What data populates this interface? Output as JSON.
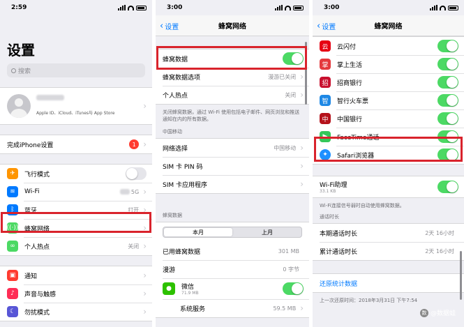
{
  "panel1": {
    "time": "2:59",
    "title": "设置",
    "search_placeholder": "搜索",
    "profile": {
      "subtitle": "Apple ID、iCloud、iTunes与 App Store"
    },
    "setup": {
      "label": "完成iPhone设置",
      "badge": "1"
    },
    "rows": [
      {
        "label": "飞行模式",
        "icon": "airplane-icon",
        "color": "#ff9500"
      },
      {
        "label": "Wi-Fi",
        "icon": "wifi-icon",
        "color": "#007aff",
        "value": "5G"
      },
      {
        "label": "蓝牙",
        "icon": "bluetooth-icon",
        "color": "#007aff",
        "value": "打开"
      },
      {
        "label": "蜂窝网络",
        "icon": "cellular-icon",
        "color": "#4cd964"
      },
      {
        "label": "个人热点",
        "icon": "hotspot-icon",
        "color": "#4cd964",
        "value": "关闭"
      }
    ],
    "rows2": [
      {
        "label": "通知",
        "icon": "notification-icon",
        "color": "#ff3b30"
      },
      {
        "label": "声音与触感",
        "icon": "sound-icon",
        "color": "#ff2d55"
      },
      {
        "label": "勿扰模式",
        "icon": "moon-icon",
        "color": "#5856d6"
      }
    ]
  },
  "panel2": {
    "time": "3:00",
    "back": "设置",
    "title": "蜂窝网络",
    "cellular_data": "蜂窝数据",
    "options": {
      "label": "蜂窝数据选项",
      "value": "漫游已关闭"
    },
    "hotspot": {
      "label": "个人热点",
      "value": "关闭"
    },
    "footnote": "关闭蜂窝数据，通过 Wi-Fi 使用包括电子邮件、网页浏览和推送通知在内的所有数据。",
    "carrier_header": "中国移动",
    "carrier_rows": [
      {
        "label": "网络选择",
        "value": "中国移动"
      },
      {
        "label": "SIM 卡 PIN 码",
        "value": ""
      },
      {
        "label": "SIM 卡应用程序",
        "value": ""
      }
    ],
    "data_header": "蜂窝数据",
    "segments": [
      "本月",
      "上月"
    ],
    "usage": [
      {
        "label": "已用蜂窝数据",
        "value": "301 MB"
      },
      {
        "label": "漫游",
        "value": "0 字节"
      }
    ],
    "wechat": {
      "label": "微信",
      "size": "71.9 MB"
    },
    "system": {
      "label": "系统服务",
      "value": "59.5 MB"
    }
  },
  "panel3": {
    "time": "3:00",
    "back": "设置",
    "title": "蜂窝网络",
    "apps": [
      {
        "label": "云闪付",
        "icon": "unionpay-icon",
        "color": "#e60012"
      },
      {
        "label": "掌上生活",
        "icon": "palm-life-icon",
        "color": "#e4393c"
      },
      {
        "label": "招商银行",
        "icon": "cmb-icon",
        "color": "#c8102e"
      },
      {
        "label": "智行火车票",
        "icon": "train-icon",
        "color": "#1e88e5"
      },
      {
        "label": "中国银行",
        "icon": "boc-icon",
        "color": "#b5121b"
      },
      {
        "label": "FaceTime通话",
        "icon": "facetime-icon",
        "color": "#34c759"
      },
      {
        "label": "Safari浏览器",
        "icon": "safari-icon",
        "color": "#1e90ff"
      }
    ],
    "wifi_assist": {
      "label": "Wi-Fi助理",
      "size": "33.1 KB"
    },
    "wifi_footnote": "Wi-Fi连接信号弱时自动使用蜂窝数据。",
    "call_header": "通话时长",
    "calls": [
      {
        "label": "本期通话时长",
        "value": "2天 16小时"
      },
      {
        "label": "累计通话时长",
        "value": "2天 16小时"
      }
    ],
    "reset": "还原统计数据",
    "last_reset": "上一次还原时间：2018年3月31日 下午7:54"
  },
  "watermark": "@数据蛙"
}
